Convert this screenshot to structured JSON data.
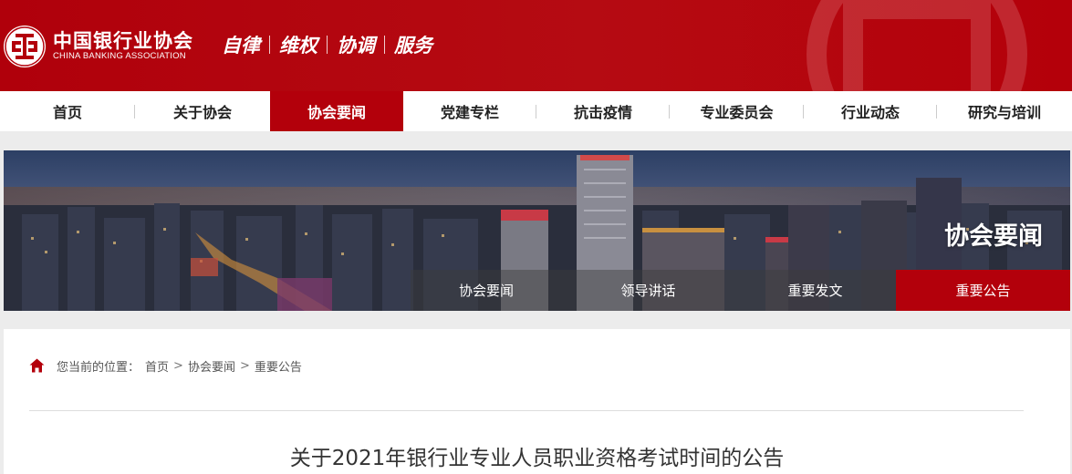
{
  "header": {
    "logo_icon": "cba-emblem-icon",
    "org_name_cn": "中国银行业协会",
    "org_name_en": "CHINA BANKING ASSOCIATION",
    "slogan": [
      "自律",
      "维权",
      "协调",
      "服务"
    ],
    "brand_color": "#b3000b"
  },
  "nav": {
    "items": [
      {
        "label": "首页"
      },
      {
        "label": "关于协会"
      },
      {
        "label": "协会要闻",
        "active": true
      },
      {
        "label": "党建专栏"
      },
      {
        "label": "抗击疫情"
      },
      {
        "label": "专业委员会"
      },
      {
        "label": "行业动态"
      },
      {
        "label": "研究与培训"
      }
    ]
  },
  "banner": {
    "title": "协会要闻",
    "subnav": [
      {
        "label": "协会要闻"
      },
      {
        "label": "领导讲话"
      },
      {
        "label": "重要发文"
      },
      {
        "label": "重要公告",
        "active": true
      }
    ]
  },
  "breadcrumb": {
    "icon": "home-icon",
    "prefix": "您当前的位置：",
    "items": [
      "首页",
      "协会要闻",
      "重要公告"
    ],
    "separator": ">"
  },
  "article": {
    "title": "关于2021年银行业专业人员职业资格考试时间的公告"
  }
}
